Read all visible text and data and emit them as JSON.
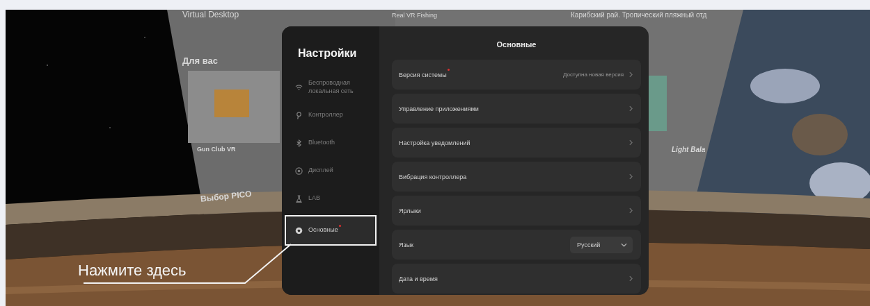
{
  "background": {
    "left_panel": {
      "title": "Virtual Desktop",
      "section": "Для вас",
      "game": "Gun Club VR",
      "section_2": "Выбор PICO"
    },
    "center_panel": {
      "title": "Real VR Fishing"
    },
    "right_panel": {
      "title": "Карибский рай. Тропический пляжный отд",
      "game": "Light Bala"
    }
  },
  "settings": {
    "title": "Настройки",
    "heading": "Основные",
    "sidebar": [
      {
        "label": "Беспроводная локальная сеть",
        "kind": "wifi",
        "selected": false,
        "dot": false
      },
      {
        "label": "Контроллер",
        "kind": "controller",
        "selected": false,
        "dot": false
      },
      {
        "label": "Bluetooth",
        "kind": "bluetooth",
        "selected": false,
        "dot": false
      },
      {
        "label": "Дисплей",
        "kind": "display",
        "selected": false,
        "dot": false
      },
      {
        "label": "LAB",
        "kind": "lab",
        "selected": false,
        "dot": false
      },
      {
        "label": "Основные",
        "kind": "gear",
        "selected": true,
        "dot": true
      }
    ],
    "rows": [
      {
        "kind": "link",
        "label": "Версия системы",
        "dot": true,
        "value": "Доступна новая версия"
      },
      {
        "kind": "link",
        "label": "Управление приложениями",
        "dot": false
      },
      {
        "kind": "link",
        "label": "Настройка уведомлений",
        "dot": false
      },
      {
        "kind": "link",
        "label": "Вибрация контроллера",
        "dot": false
      },
      {
        "kind": "link",
        "label": "Ярлыки",
        "dot": false
      },
      {
        "kind": "dropdown",
        "label": "Язык",
        "dot": false,
        "value": "Русский"
      },
      {
        "kind": "link",
        "label": "Дата и время",
        "dot": false
      }
    ]
  },
  "callout": "Нажмите здесь"
}
